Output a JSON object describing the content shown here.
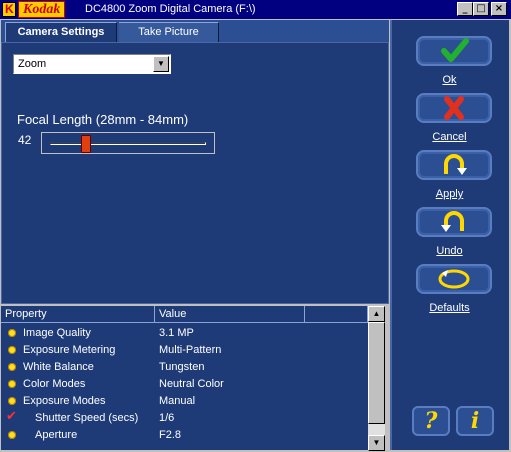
{
  "window": {
    "title": "DC4800 Zoom Digital Camera (F:\\)",
    "logo_text": "Kodak",
    "minimize": "_",
    "maximize": "□",
    "close": "×"
  },
  "tabs": [
    {
      "label": "Camera Settings",
      "active": true
    },
    {
      "label": "Take Picture",
      "active": false
    }
  ],
  "setting_select": {
    "value": "Zoom",
    "arrow": "▼"
  },
  "focal": {
    "label": "Focal Length (28mm - 84mm)",
    "value": "42",
    "min": 28,
    "max": 84,
    "current": 42
  },
  "table": {
    "headers": {
      "property": "Property",
      "value": "Value"
    },
    "rows": [
      {
        "label": "Image Quality",
        "value": "3.1 MP",
        "marker": "bullet",
        "indent": false
      },
      {
        "label": "Exposure Metering",
        "value": "Multi-Pattern",
        "marker": "bullet",
        "indent": false
      },
      {
        "label": "White Balance",
        "value": "Tungsten",
        "marker": "bullet",
        "indent": false
      },
      {
        "label": "Color Modes",
        "value": "Neutral Color",
        "marker": "bullet",
        "indent": false
      },
      {
        "label": "Exposure Modes",
        "value": "Manual",
        "marker": "bullet",
        "indent": false
      },
      {
        "label": "Shutter Speed (secs)",
        "value": "1/6",
        "marker": "check",
        "indent": true
      },
      {
        "label": "Aperture",
        "value": "F2.8",
        "marker": "bullet",
        "indent": true
      }
    ],
    "scroll_up": "▲",
    "scroll_down": "▼"
  },
  "actions": {
    "ok": "Ok",
    "cancel": "Cancel",
    "apply": "Apply",
    "undo": "Undo",
    "defaults": "Defaults"
  },
  "help_glyph": "?",
  "info_glyph": "i",
  "colors": {
    "panel_blue": "#1e3b78",
    "title_blue": "#000080",
    "ok_green": "#22b030",
    "cancel_red": "#e03020",
    "icon_yellow": "#ffd800"
  }
}
